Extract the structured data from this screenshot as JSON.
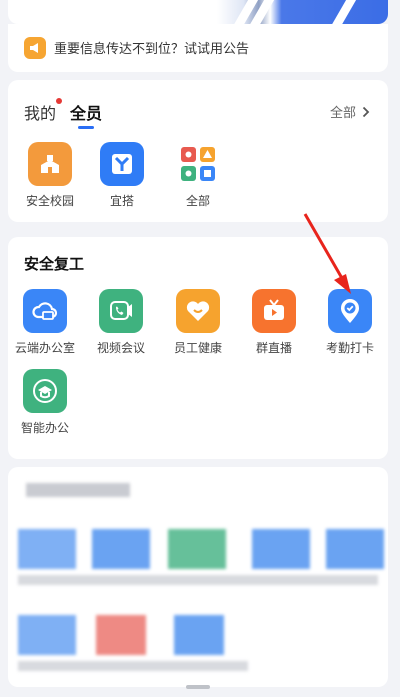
{
  "notice": {
    "text": "重要信息传达不到位？试试用公告",
    "icon": "megaphone-icon",
    "icon_color": "#f6a532"
  },
  "apps_section": {
    "tabs": [
      {
        "label": "我的",
        "active": false,
        "has_badge": true
      },
      {
        "label": "全员",
        "active": true,
        "has_badge": false
      }
    ],
    "all_link": "全部",
    "items": [
      {
        "label": "安全校园",
        "icon": "campus-building-icon",
        "color": "#f39a3c"
      },
      {
        "label": "宜搭",
        "icon": "yida-icon",
        "color": "#2f7cf6"
      },
      {
        "label": "全部",
        "icon": "all-apps-grid-icon",
        "color": "#ffffff"
      }
    ]
  },
  "safe_return": {
    "title": "安全复工",
    "items": [
      {
        "label": "云端办公室",
        "icon": "cloud-office-icon",
        "color": "#3a86f7"
      },
      {
        "label": "视频会议",
        "icon": "video-call-icon",
        "color": "#3fb27f"
      },
      {
        "label": "员工健康",
        "icon": "heart-health-icon",
        "color": "#f6a32e"
      },
      {
        "label": "群直播",
        "icon": "tv-live-icon",
        "color": "#f7732e"
      },
      {
        "label": "考勤打卡",
        "icon": "location-check-icon",
        "color": "#3a86f7"
      },
      {
        "label": "智能办公",
        "icon": "smart-office-icon",
        "color": "#3fb27f"
      }
    ]
  },
  "colors": {
    "accent": "#2a6ef5",
    "badge": "#e53935",
    "annotation_arrow": "#e8241c"
  }
}
